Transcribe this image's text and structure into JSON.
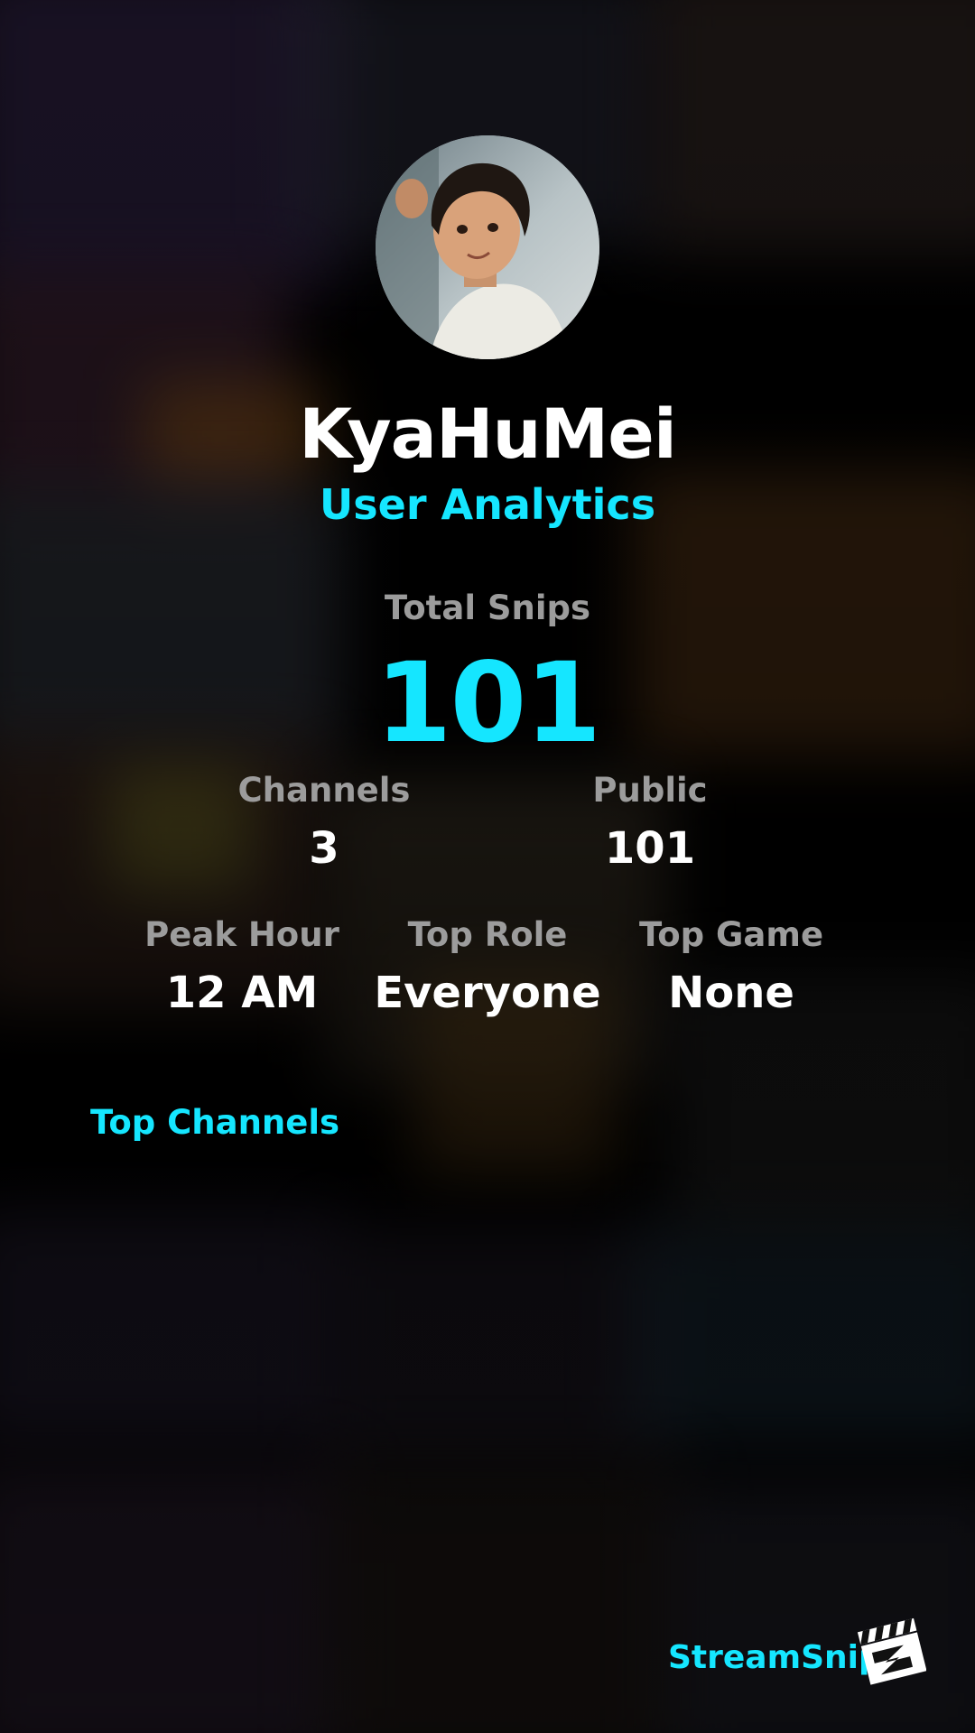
{
  "profile": {
    "username": "KyaHuMei",
    "subtitle": "User Analytics",
    "avatar_icon": "user-avatar-photo"
  },
  "stats": {
    "total_snips": {
      "label": "Total Snips",
      "value": "101"
    },
    "channels": {
      "label": "Channels",
      "value": "3"
    },
    "public": {
      "label": "Public",
      "value": "101"
    },
    "peak_hour": {
      "label": "Peak Hour",
      "value": "12 AM"
    },
    "top_role": {
      "label": "Top Role",
      "value": "Everyone"
    },
    "top_game": {
      "label": "Top Game",
      "value": "None"
    }
  },
  "sections": {
    "top_channels": "Top Channels"
  },
  "brand": {
    "name": "StreamSnip",
    "logo_icon": "clapperboard-logo-icon"
  },
  "colors": {
    "accent": "#15e6ff",
    "label": "#9c9c9c",
    "text": "#ffffff",
    "background": "#000000"
  }
}
